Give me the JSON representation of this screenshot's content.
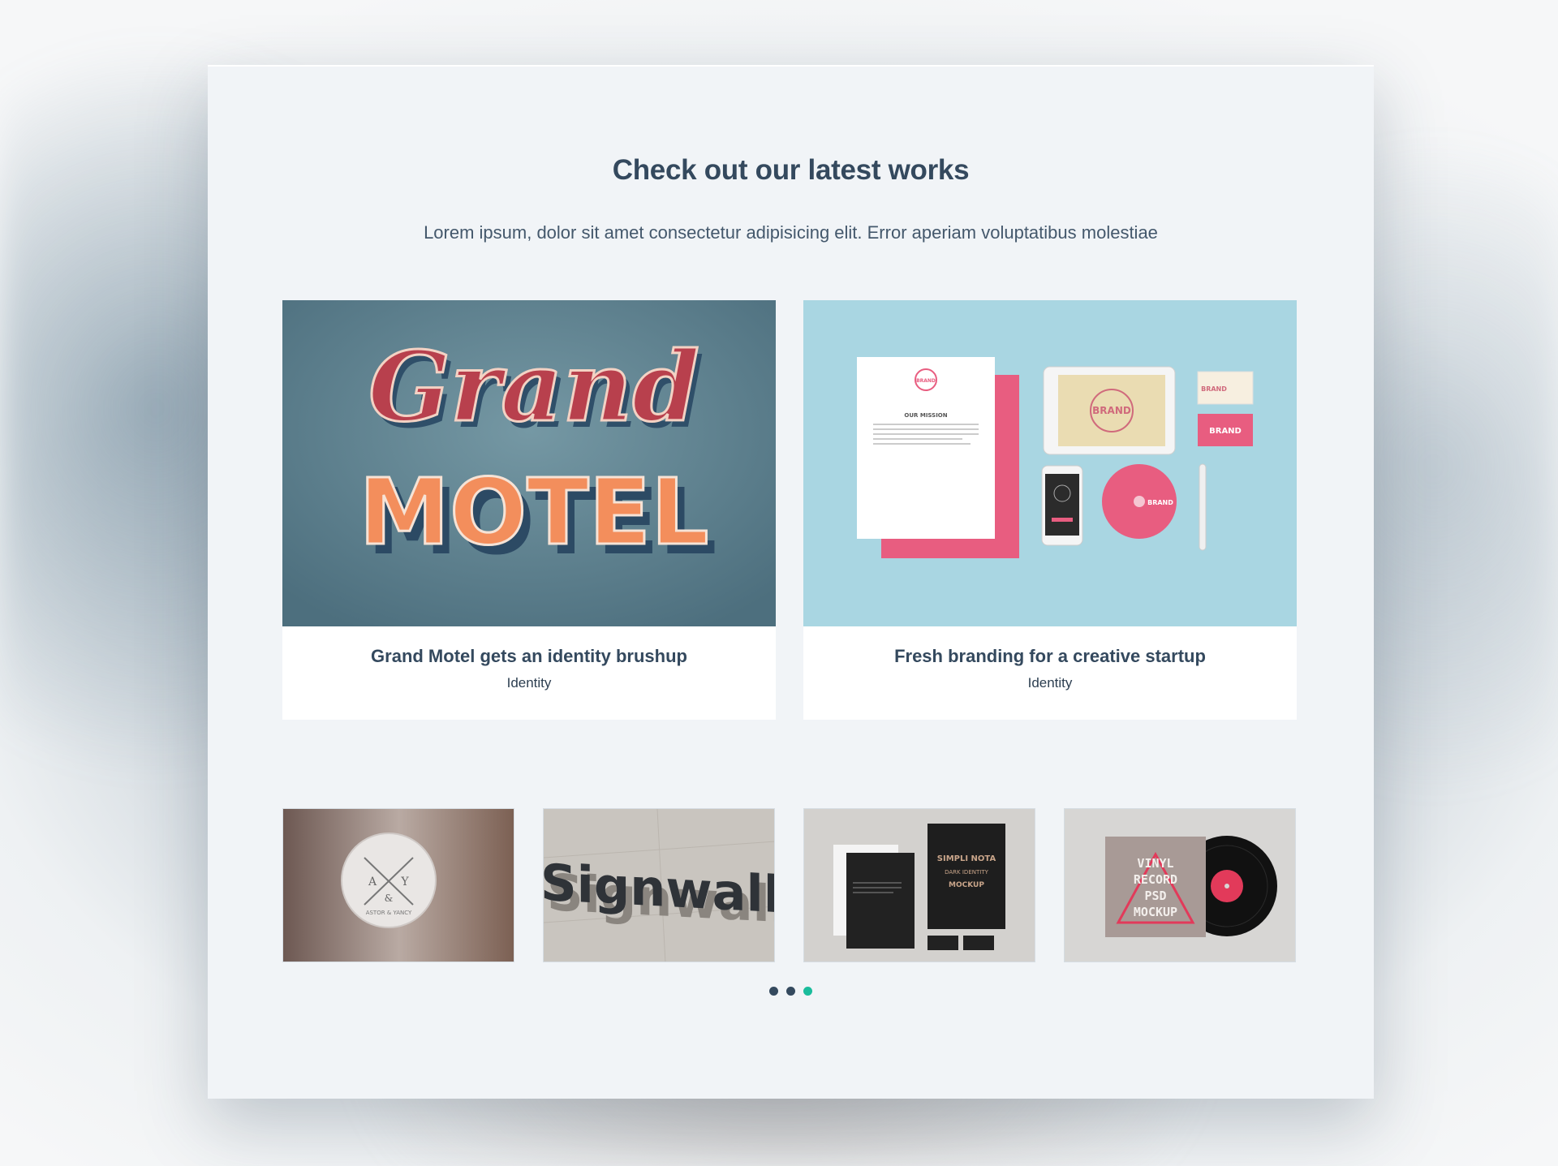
{
  "section": {
    "title": "Check out our latest works",
    "subtitle": "Lorem ipsum, dolor sit amet consectetur adipisicing elit. Error aperiam voluptatibus molestiae"
  },
  "featured": [
    {
      "title": "Grand Motel gets an identity brushup",
      "category": "Identity",
      "image_text": {
        "script": "Grand",
        "block": "MOTEL"
      }
    },
    {
      "title": "Fresh branding for a creative startup",
      "category": "Identity",
      "image_text": {
        "brand": "BRAND",
        "mission": "OUR MISSION"
      }
    }
  ],
  "thumbnails": [
    {
      "image_text": {
        "a": "A",
        "y": "Y",
        "amp": "&",
        "name": "ASTOR & YANCY"
      }
    },
    {
      "image_text": {
        "word": "Signwall"
      }
    },
    {
      "image_text": {
        "line1": "SIMPLI NOTA",
        "line2": "DARK IDENTITY",
        "line3": "MOCKUP"
      }
    },
    {
      "image_text": {
        "line1": "VINYL",
        "line2": "RECORD",
        "line3": "PSD",
        "line4": "MOCKUP"
      }
    }
  ],
  "pagination": {
    "count": 3,
    "active_index": 2
  },
  "colors": {
    "heading": "#34495e",
    "active_dot": "#1abc9c",
    "dot": "#34495e",
    "panel": "#f1f4f7"
  }
}
